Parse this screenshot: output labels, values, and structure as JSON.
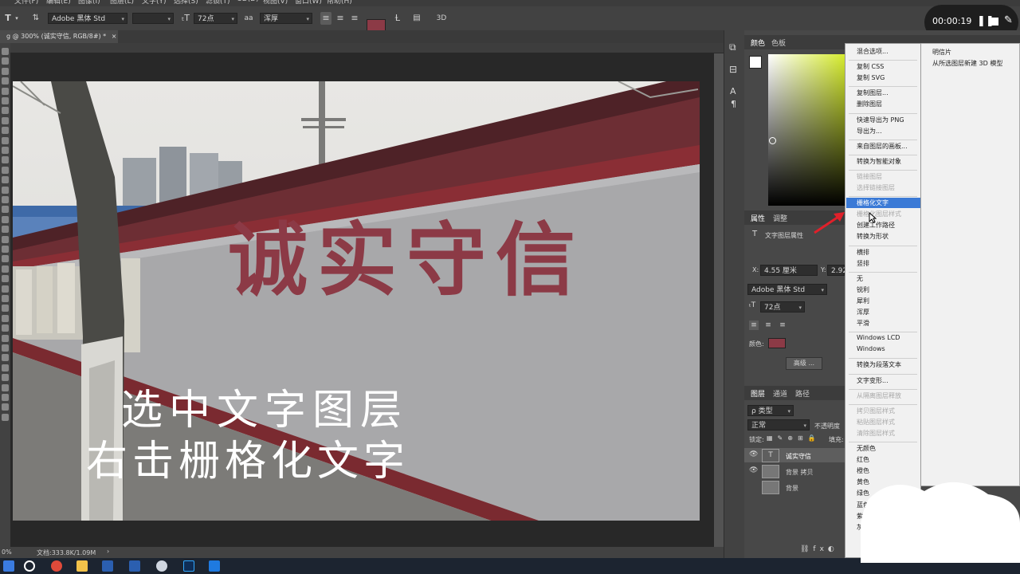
{
  "menubar": [
    "文件(F)",
    "编辑(E)",
    "图像(I)",
    "图层(L)",
    "文字(Y)",
    "选择(S)",
    "滤镜(T)",
    "3D(D)",
    "视图(V)",
    "窗口(W)",
    "帮助(H)"
  ],
  "options": {
    "tool_icon": "T",
    "font_family": "Adobe 黑体 Std",
    "font_size": "72点",
    "aa_icon": "aa",
    "anti_alias": "浑厚",
    "text_color": "#8c3a46",
    "three_d": "3D"
  },
  "timer": {
    "time": "00:00:19"
  },
  "doc_tab": {
    "title": "g @ 300% (诚实守信, RGB/8#) *",
    "close": "×"
  },
  "canvas": {
    "wall_text": "诚实守信",
    "caption_line1": "选中文字图层",
    "caption_line2": "右击栅格化文字"
  },
  "status": {
    "zoom": "0%",
    "doc": "文档:333.8K/1.09M"
  },
  "panels": {
    "color_tabs": [
      "颜色",
      "色板"
    ],
    "properties_tabs": [
      "属性",
      "调整"
    ],
    "text_layer_props": "文字图层属性",
    "x_label": "X:",
    "x_value": "4.55 厘米",
    "y_label": "Y:",
    "y_value": "2.92",
    "font_family": "Adobe 黑体 Std",
    "font_size": "72点",
    "color_label": "颜色:",
    "advanced_btn": "高级 ...",
    "layers_tabs": [
      "图层",
      "通道",
      "路径"
    ],
    "kind_filter": "ρ 类型",
    "blend_mode": "正常",
    "opacity_label": "不透明度",
    "lock_label": "锁定:",
    "fill_label": "填充:",
    "layers": [
      {
        "name": "诚实守信",
        "type": "text"
      },
      {
        "name": "背景 拷贝",
        "type": "image"
      },
      {
        "name": "背景",
        "type": "image"
      }
    ]
  },
  "context_menu": {
    "items": [
      {
        "label": "混合选项...",
        "disabled": false
      },
      {
        "sep": true
      },
      {
        "label": "复制 CSS",
        "disabled": false
      },
      {
        "label": "复制 SVG",
        "disabled": false
      },
      {
        "sep": true
      },
      {
        "label": "复制图层...",
        "disabled": false
      },
      {
        "label": "删除图层",
        "disabled": false
      },
      {
        "sep": true
      },
      {
        "label": "快速导出为 PNG",
        "disabled": false
      },
      {
        "label": "导出为...",
        "disabled": false
      },
      {
        "sep": true
      },
      {
        "label": "来自图层的画板...",
        "disabled": false
      },
      {
        "sep": true
      },
      {
        "label": "转换为智能对象",
        "disabled": false
      },
      {
        "sep": true
      },
      {
        "label": "链接图层",
        "disabled": true
      },
      {
        "label": "选择链接图层",
        "disabled": true
      },
      {
        "sep": true
      },
      {
        "label": "栅格化文字",
        "disabled": false,
        "highlighted": true
      },
      {
        "label": "栅格化图层样式",
        "disabled": true
      },
      {
        "label": "创建工作路径",
        "disabled": false
      },
      {
        "label": "转换为形状",
        "disabled": false
      },
      {
        "sep": true
      },
      {
        "label": "横排",
        "disabled": false
      },
      {
        "label": "竖排",
        "disabled": false
      },
      {
        "sep": true
      },
      {
        "label": "无",
        "disabled": false
      },
      {
        "label": "锐利",
        "disabled": false
      },
      {
        "label": "犀利",
        "disabled": false
      },
      {
        "label": "浑厚",
        "disabled": false
      },
      {
        "label": "平滑",
        "disabled": false
      },
      {
        "sep": true
      },
      {
        "label": "Windows LCD",
        "disabled": false
      },
      {
        "label": "Windows",
        "disabled": false
      },
      {
        "sep": true
      },
      {
        "label": "转换为段落文本",
        "disabled": false
      },
      {
        "sep": true
      },
      {
        "label": "文字变形...",
        "disabled": false
      },
      {
        "sep": true
      },
      {
        "label": "从隔离图层释放",
        "disabled": true
      },
      {
        "sep": true
      },
      {
        "label": "拷贝图层样式",
        "disabled": true
      },
      {
        "label": "粘贴图层样式",
        "disabled": true
      },
      {
        "label": "清除图层样式",
        "disabled": true
      },
      {
        "sep": true
      },
      {
        "label": "无颜色",
        "disabled": false
      },
      {
        "label": "红色",
        "disabled": false
      },
      {
        "label": "橙色",
        "disabled": false
      },
      {
        "label": "黄色",
        "disabled": false
      },
      {
        "label": "绿色",
        "disabled": false
      },
      {
        "label": "蓝色",
        "disabled": false
      },
      {
        "label": "紫色",
        "disabled": false
      },
      {
        "label": "灰色",
        "disabled": false
      }
    ],
    "sub_items": [
      "明信片",
      "从所选图层新建 3D 模型"
    ]
  },
  "colors": {
    "brand_text": "#8c3a46",
    "highlight": "#3b7ad6",
    "arrow": "#e0202a"
  }
}
